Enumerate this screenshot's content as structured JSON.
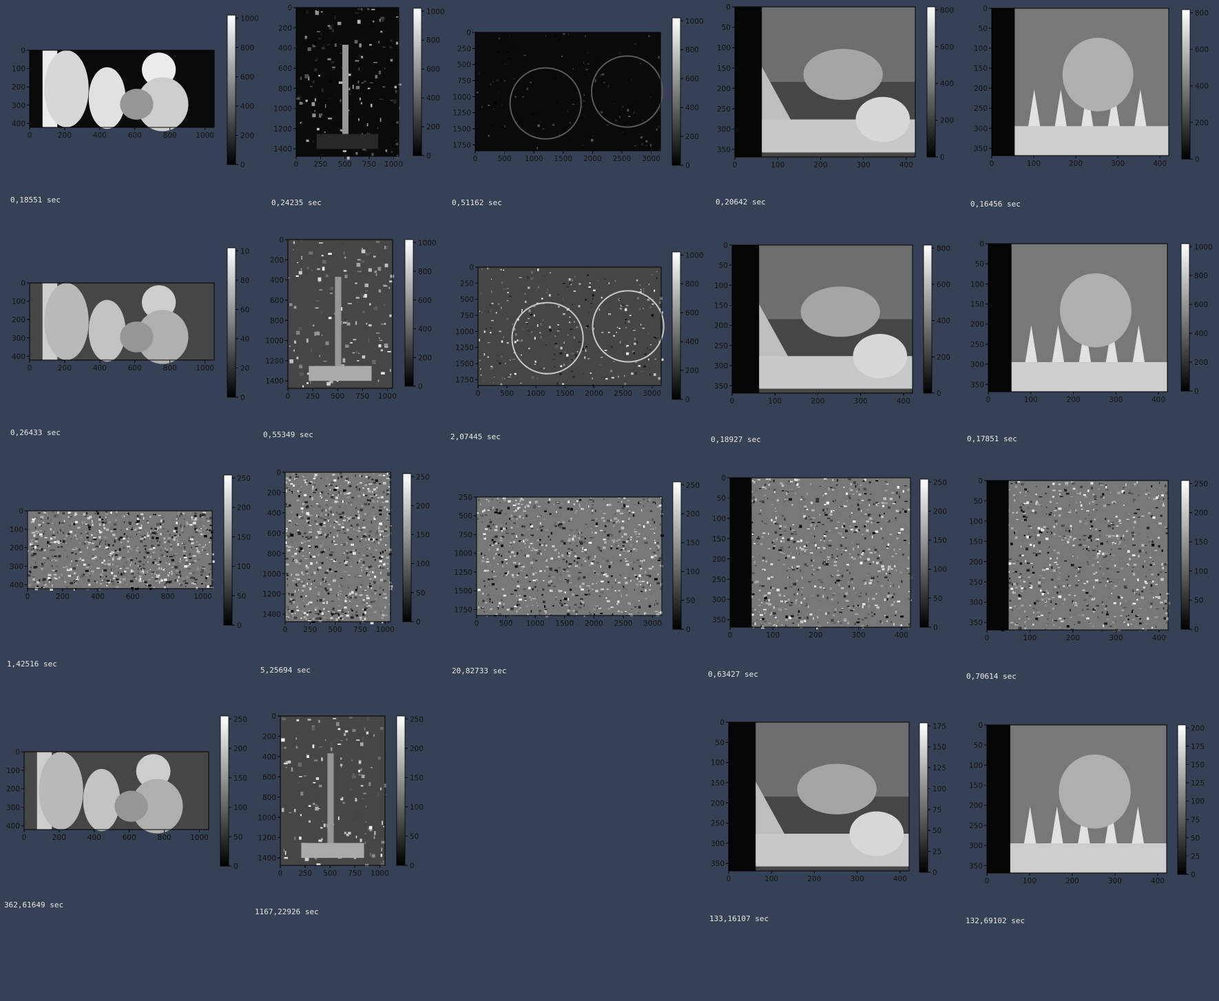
{
  "colors": {
    "background": "#364155",
    "axis": "#000000",
    "image_dark": "#0a0a0a",
    "image_light": "#f2f2f2"
  },
  "chart_data": [
    {
      "type": "heatmap",
      "xticks": [
        "0",
        "200",
        "400",
        "600",
        "800",
        "1000"
      ],
      "yticks": [
        "0",
        "100",
        "200",
        "300",
        "400"
      ],
      "cbar_ticks": [
        "0",
        "200",
        "400",
        "600",
        "800",
        "1000"
      ],
      "scene": "people",
      "pattern": "dark",
      "time": "0,18551 sec"
    },
    {
      "type": "heatmap",
      "xticks": [
        "0",
        "250",
        "500",
        "750",
        "1000"
      ],
      "yticks": [
        "0",
        "200",
        "400",
        "600",
        "800",
        "1000",
        "1200",
        "1400"
      ],
      "cbar_ticks": [
        "0",
        "200",
        "400",
        "600",
        "800",
        "1000"
      ],
      "scene": "tree",
      "pattern": "dark",
      "time": "0,24235 sec"
    },
    {
      "type": "heatmap",
      "xticks": [
        "0",
        "500",
        "1000",
        "1500",
        "2000",
        "2500",
        "3000"
      ],
      "yticks": [
        "0",
        "250",
        "500",
        "750",
        "1000",
        "1250",
        "1500",
        "1750"
      ],
      "cbar_ticks": [
        "0",
        "200",
        "400",
        "600",
        "800",
        "1000"
      ],
      "scene": "bike",
      "pattern": "dark",
      "time": "0,51162 sec"
    },
    {
      "type": "heatmap",
      "xticks": [
        "0",
        "100",
        "200",
        "300",
        "400"
      ],
      "yticks": [
        "0",
        "50",
        "100",
        "150",
        "200",
        "250",
        "300",
        "350"
      ],
      "cbar_ticks": [
        "0",
        "200",
        "400",
        "600",
        "800"
      ],
      "scene": "teddy",
      "pattern": "smooth",
      "time": "0,20642 sec"
    },
    {
      "type": "heatmap",
      "xticks": [
        "0",
        "100",
        "200",
        "300",
        "400"
      ],
      "yticks": [
        "0",
        "50",
        "100",
        "150",
        "200",
        "250",
        "300",
        "350"
      ],
      "cbar_ticks": [
        "0",
        "200",
        "400",
        "600",
        "800"
      ],
      "scene": "cones",
      "pattern": "smooth",
      "time": "0,16456 sec"
    },
    {
      "type": "heatmap",
      "xticks": [
        "0",
        "200",
        "400",
        "600",
        "800",
        "1000"
      ],
      "yticks": [
        "0",
        "100",
        "200",
        "300",
        "400"
      ],
      "cbar_ticks": [
        "0",
        "20",
        "40",
        "60",
        "80",
        "10"
      ],
      "scene": "people",
      "pattern": "smooth",
      "time": "0,26433 sec"
    },
    {
      "type": "heatmap",
      "xticks": [
        "0",
        "250",
        "500",
        "750",
        "1000"
      ],
      "yticks": [
        "0",
        "200",
        "400",
        "600",
        "800",
        "1000",
        "1200",
        "1400"
      ],
      "cbar_ticks": [
        "0",
        "200",
        "400",
        "600",
        "800",
        "1000"
      ],
      "scene": "tree",
      "pattern": "mixed",
      "time": "0,55349 sec"
    },
    {
      "type": "heatmap",
      "xticks": [
        "0",
        "500",
        "1000",
        "1500",
        "2000",
        "2500",
        "3000"
      ],
      "yticks": [
        "0",
        "250",
        "500",
        "750",
        "1000",
        "1250",
        "1500",
        "1750"
      ],
      "cbar_ticks": [
        "0",
        "200",
        "400",
        "600",
        "800",
        "1000"
      ],
      "scene": "bike",
      "pattern": "mixed",
      "time": "2,07445 sec"
    },
    {
      "type": "heatmap",
      "xticks": [
        "0",
        "100",
        "200",
        "300",
        "400"
      ],
      "yticks": [
        "0",
        "50",
        "100",
        "150",
        "200",
        "250",
        "300",
        "350"
      ],
      "cbar_ticks": [
        "0",
        "200",
        "400",
        "600",
        "800"
      ],
      "scene": "teddy",
      "pattern": "smooth",
      "time": "0,18927 sec"
    },
    {
      "type": "heatmap",
      "xticks": [
        "0",
        "100",
        "200",
        "300",
        "400"
      ],
      "yticks": [
        "0",
        "50",
        "100",
        "150",
        "200",
        "250",
        "300",
        "350"
      ],
      "cbar_ticks": [
        "0",
        "200",
        "400",
        "600",
        "800",
        "1000"
      ],
      "scene": "cones",
      "pattern": "smooth",
      "time": "0,17851 sec"
    },
    {
      "type": "heatmap",
      "xticks": [
        "0",
        "200",
        "400",
        "600",
        "800",
        "1000"
      ],
      "yticks": [
        "0",
        "100",
        "200",
        "300",
        "400"
      ],
      "cbar_ticks": [
        "0",
        "50",
        "100",
        "150",
        "200",
        "250"
      ],
      "scene": "people",
      "pattern": "noise",
      "time": "1,42516 sec"
    },
    {
      "type": "heatmap",
      "xticks": [
        "0",
        "250",
        "500",
        "750",
        "1000"
      ],
      "yticks": [
        "0",
        "200",
        "400",
        "600",
        "800",
        "1000",
        "1200",
        "1400"
      ],
      "cbar_ticks": [
        "0",
        "50",
        "100",
        "150",
        "200",
        "250"
      ],
      "scene": "tree",
      "pattern": "noise",
      "time": "5,25694 sec"
    },
    {
      "type": "heatmap",
      "xticks": [
        "0",
        "500",
        "1000",
        "1500",
        "2000",
        "2500",
        "3000"
      ],
      "yticks": [
        "250",
        "500",
        "750",
        "1000",
        "1250",
        "1500",
        "1750"
      ],
      "cbar_ticks": [
        "0",
        "50",
        "100",
        "150",
        "200",
        "250"
      ],
      "scene": "bike",
      "pattern": "noise",
      "time": "20,82733 sec"
    },
    {
      "type": "heatmap",
      "xticks": [
        "0",
        "100",
        "200",
        "300",
        "400"
      ],
      "yticks": [
        "0",
        "50",
        "100",
        "150",
        "200",
        "250",
        "300",
        "350"
      ],
      "cbar_ticks": [
        "0",
        "50",
        "100",
        "150",
        "200",
        "250"
      ],
      "scene": "teddy",
      "pattern": "noise",
      "time": "0,63427 sec"
    },
    {
      "type": "heatmap",
      "xticks": [
        "0",
        "100",
        "200",
        "300",
        "400"
      ],
      "yticks": [
        "0",
        "50",
        "100",
        "150",
        "200",
        "250",
        "300",
        "350"
      ],
      "cbar_ticks": [
        "0",
        "50",
        "100",
        "150",
        "200",
        "250"
      ],
      "scene": "cones",
      "pattern": "noise",
      "time": "0,70614 sec"
    },
    {
      "type": "heatmap",
      "xticks": [
        "0",
        "200",
        "400",
        "600",
        "800",
        "1000"
      ],
      "yticks": [
        "0",
        "100",
        "200",
        "300",
        "400"
      ],
      "cbar_ticks": [
        "0",
        "50",
        "100",
        "150",
        "200",
        "250"
      ],
      "scene": "people",
      "pattern": "smooth",
      "time": "362,61649 sec"
    },
    {
      "type": "heatmap",
      "xticks": [
        "0",
        "250",
        "500",
        "750",
        "1000"
      ],
      "yticks": [
        "0",
        "200",
        "400",
        "600",
        "800",
        "1000",
        "1200",
        "1400"
      ],
      "cbar_ticks": [
        "0",
        "50",
        "100",
        "150",
        "200",
        "250"
      ],
      "scene": "tree",
      "pattern": "mixed",
      "time": "1167,22926 sec"
    },
    {
      "type": "heatmap",
      "xticks": [
        "0",
        "100",
        "200",
        "300",
        "400"
      ],
      "yticks": [
        "0",
        "50",
        "100",
        "150",
        "200",
        "250",
        "300",
        "350"
      ],
      "cbar_ticks": [
        "0",
        "25",
        "50",
        "75",
        "100",
        "125",
        "150",
        "175"
      ],
      "scene": "teddy",
      "pattern": "smooth",
      "time": "133,16107 sec"
    },
    {
      "type": "heatmap",
      "xticks": [
        "0",
        "100",
        "200",
        "300",
        "400"
      ],
      "yticks": [
        "0",
        "50",
        "100",
        "150",
        "200",
        "250",
        "300",
        "350"
      ],
      "cbar_ticks": [
        "0",
        "25",
        "50",
        "75",
        "100",
        "125",
        "150",
        "175",
        "200"
      ],
      "scene": "cones",
      "pattern": "smooth",
      "time": "132,69102 sec"
    }
  ]
}
